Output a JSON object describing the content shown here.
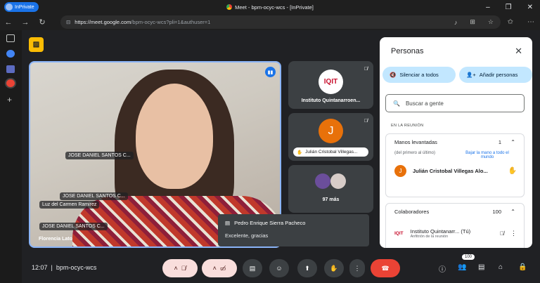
{
  "browser": {
    "inprivate_label": "InPrivate",
    "window_title": "Meet - bpm-ocyc-wcs - [InPrivate]",
    "url_host": "https://meet.google.com",
    "url_path": "/bpm-ocyc-wcs?pli=1&authuser=1"
  },
  "main_tile": {
    "labels": [
      "JOSE DANIEL SANTOS C...",
      "JOSE DANIEL SANTOS C...",
      "Luz del Carmen Ramirez",
      "JOSE DANIEL SANTOS C..."
    ],
    "speaker": "Florencia Lato"
  },
  "tiles": [
    {
      "logo": "IQIT",
      "name": "Instituto Quintanarroen..."
    },
    {
      "initial": "J",
      "name": "Julián Cristobal Villegas..."
    },
    {
      "count": "97 más"
    }
  ],
  "chat": {
    "sender": "Pedro Enrique Sierra Pacheco",
    "message": "Excelente, gracias"
  },
  "panel": {
    "title": "Personas",
    "mute_all": "Silenciar a todos",
    "add_people": "Añadir personas",
    "search_placeholder": "Buscar a gente",
    "section": "EN LA REUNIÓN",
    "hands": {
      "label": "Manos levantadas",
      "count": "1",
      "order": "(del primero al último)",
      "lower_all": "Bajar la mano a todo el mundo",
      "person": "Julián Cristobal Villegas Alo...",
      "initial": "J"
    },
    "collab": {
      "label": "Colaboradores",
      "count": "100",
      "person": "Instituto Quintanarr...",
      "you": "(Tú)",
      "role": "Anfitrión de la reunión",
      "logo": "IQIT"
    }
  },
  "bar": {
    "time": "12:07",
    "code": "bpm-ocyc-wcs",
    "participants_badge": "100"
  }
}
